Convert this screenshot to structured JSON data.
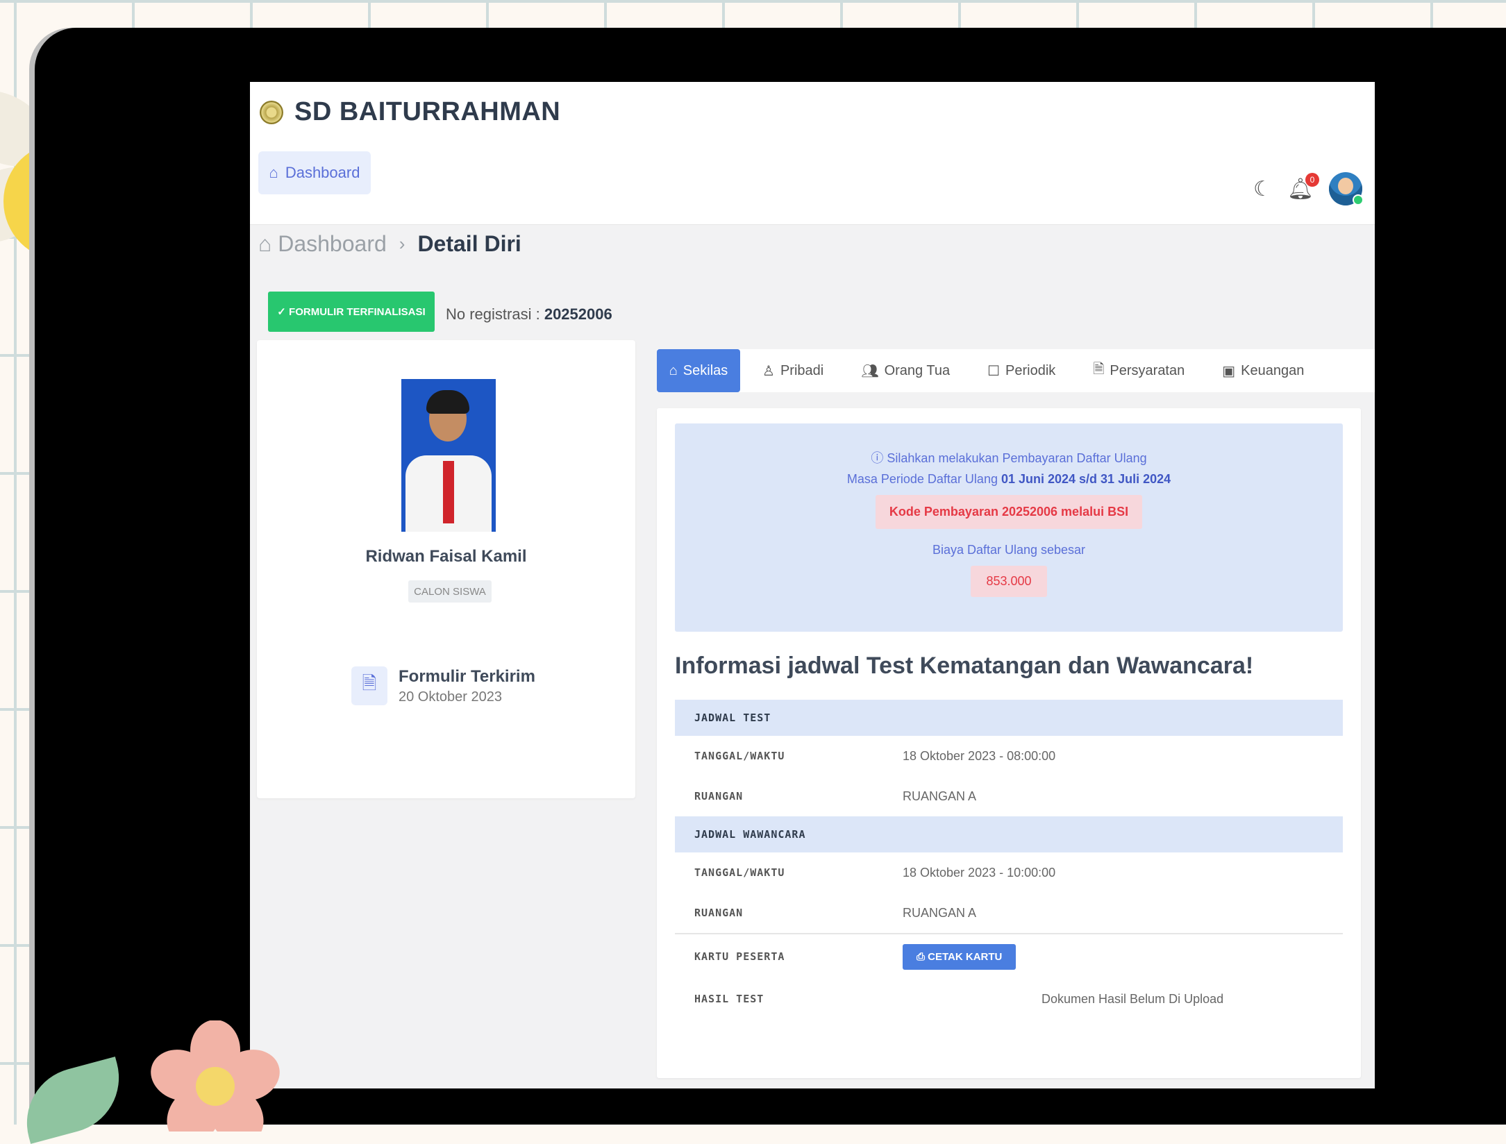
{
  "app": {
    "school_name": "SD BAITURRAHMAN",
    "nav_button": "Dashboard",
    "notification_count": "0"
  },
  "breadcrumb": {
    "home": "Dashboard",
    "separator": "›",
    "current": "Detail Diri"
  },
  "status": {
    "badge": "✓ FORMULIR TERFINALISASI",
    "reg_label": "No registrasi : ",
    "reg_number": "20252006"
  },
  "profile": {
    "name": "Ridwan Faisal Kamil",
    "role": "CALON SISWA",
    "form_title": "Formulir Terkirim",
    "form_date": "20 Oktober 2023"
  },
  "tabs": [
    {
      "label": "Sekilas",
      "icon": "home-icon"
    },
    {
      "label": "Pribadi",
      "icon": "user-icon"
    },
    {
      "label": "Orang Tua",
      "icon": "users-icon"
    },
    {
      "label": "Periodik",
      "icon": "square-icon"
    },
    {
      "label": "Persyaratan",
      "icon": "file-icon"
    },
    {
      "label": "Keuangan",
      "icon": "money-icon"
    }
  ],
  "payment": {
    "notice": "Silahkan melakukan Pembayaran Daftar Ulang",
    "period_prefix": "Masa Periode Daftar Ulang ",
    "period": "01 Juni 2024 s/d 31 Juli 2024",
    "code": "Kode Pembayaran 20252006 melalui BSI",
    "fee_label": "Biaya Daftar Ulang sebesar",
    "fee": "853.000"
  },
  "schedule": {
    "title": "Informasi jadwal Test Kematangan dan Wawancara!",
    "test_header": "JADWAL TEST",
    "test_datetime_label": "TANGGAL/WAKTU",
    "test_datetime": "18 Oktober 2023 - 08:00:00",
    "test_room_label": "RUANGAN",
    "test_room": "RUANGAN A",
    "interview_header": "JADWAL WAWANCARA",
    "interview_datetime_label": "TANGGAL/WAKTU",
    "interview_datetime": "18 Oktober 2023 - 10:00:00",
    "interview_room_label": "RUANGAN",
    "interview_room": "RUANGAN A",
    "card_label": "KARTU PESERTA",
    "card_button": "CETAK KARTU",
    "result_label": "HASIL TEST",
    "result_value": "Dokumen Hasil Belum Di Upload"
  }
}
